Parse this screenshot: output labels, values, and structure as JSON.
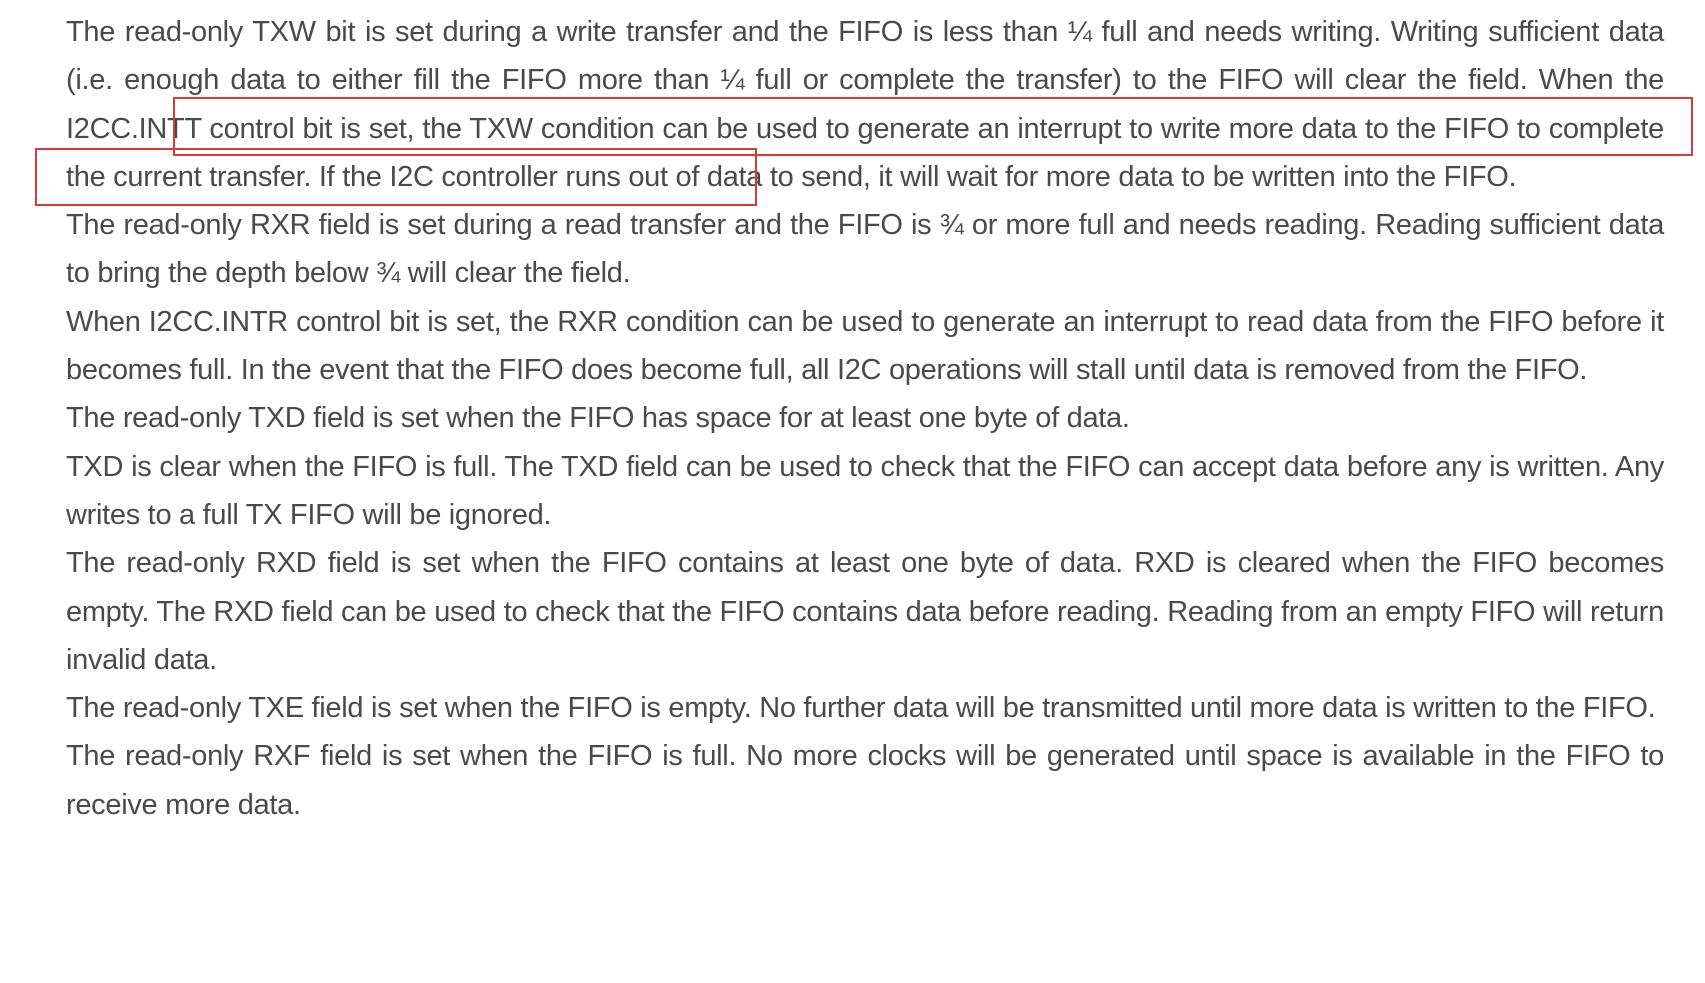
{
  "document": {
    "paragraphs": [
      {
        "before": "The read-only TXW bit is set during a write transfer and the FIFO is less than ¼ full and needs writing. Writing sufficient data (i.e. enough data to either fill the FIFO more than ¼ full or complete the transfer) to the FIFO will clear the field.",
        "highlight": " When the I2CC.INTT control bit is set, the TXW condition can be used to generate an interrupt to write more data to the FIFO to complete the current transfer.",
        "after": " If the I2C controller runs out of data to send, it will wait for more data to be written into the FIFO."
      },
      {
        "text": "The read-only RXR field is set during a read transfer and the FIFO is ¾ or more full and needs reading. Reading sufficient data to bring the depth below ¾ will clear the field."
      },
      {
        "text": "When I2CC.INTR control bit is set, the RXR condition can be used to generate an interrupt to read data from the FIFO before it becomes full. In the event that the FIFO does become full, all I2C operations will stall until data is removed from the FIFO."
      },
      {
        "text": "The read-only TXD field is set when the FIFO has space for at least one byte of data."
      },
      {
        "text": "TXD is clear when the FIFO is full. The TXD field can be used to check that the FIFO can accept data before any is written. Any writes to a full TX FIFO will be ignored."
      },
      {
        "text": "The read-only RXD field is set when the FIFO contains at least one byte of data. RXD is cleared when the FIFO becomes empty. The RXD field can be used to check that the FIFO contains data before reading. Reading from an empty FIFO will return invalid data."
      },
      {
        "text": "The read-only TXE field is set when the FIFO is empty. No further data will be transmitted until more data is written to the FIFO."
      },
      {
        "text": "The read-only RXF field is set when the FIFO is full. No more clocks will be generated until space is available in the FIFO to receive more data."
      }
    ],
    "highlight_color": "#d83a3a"
  }
}
